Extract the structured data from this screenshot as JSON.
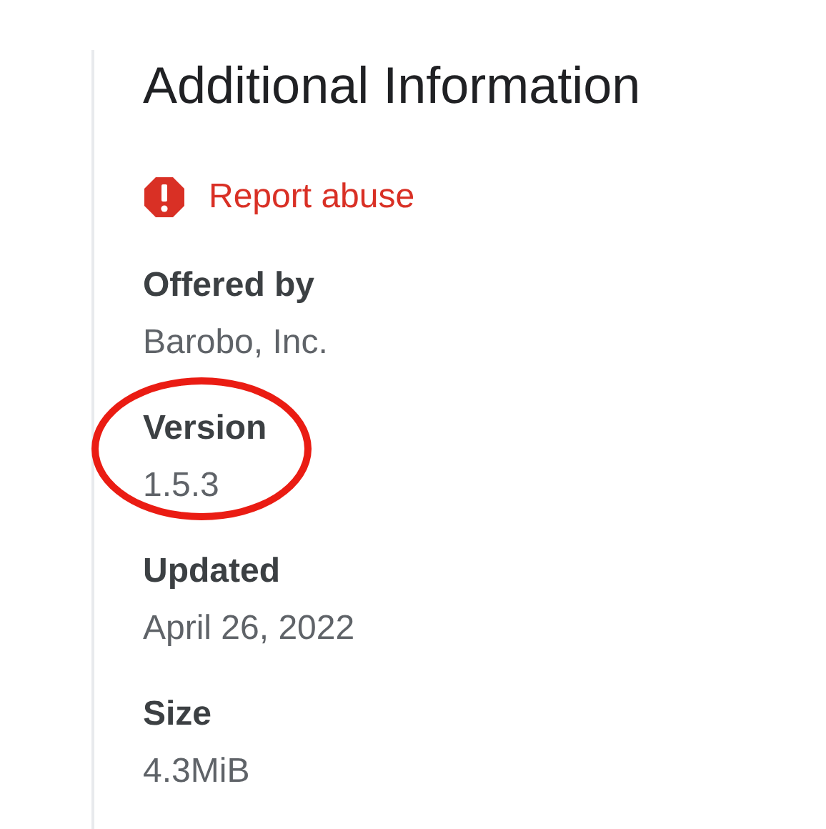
{
  "title": "Additional Information",
  "report": {
    "label": "Report abuse"
  },
  "details": [
    {
      "label": "Offered by",
      "value": "Barobo, Inc.",
      "circled": false
    },
    {
      "label": "Version",
      "value": "1.5.3",
      "circled": true
    },
    {
      "label": "Updated",
      "value": "April 26, 2022",
      "circled": false
    },
    {
      "label": "Size",
      "value": "4.3MiB",
      "circled": false
    }
  ]
}
